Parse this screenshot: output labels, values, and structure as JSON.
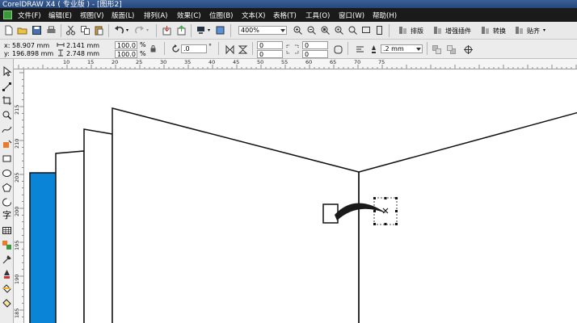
{
  "window": {
    "title": "CorelDRAW X4 ( 专业版 ) - [图形2]"
  },
  "menu": [
    "文件(F)",
    "编辑(E)",
    "视图(V)",
    "版面(L)",
    "排列(A)",
    "效果(C)",
    "位图(B)",
    "文本(X)",
    "表格(T)",
    "工具(O)",
    "窗口(W)",
    "帮助(H)"
  ],
  "toolbar": {
    "zoom": "400%",
    "buttons": {
      "arrange": "排版",
      "plugin": "增强插件",
      "convert": "转换",
      "snap": "贴齐"
    }
  },
  "property_bar": {
    "x": "58.907 mm",
    "y": "196.898 mm",
    "width": "2.141 mm",
    "height": "2.748 mm",
    "scale_x": "100.0",
    "scale_y": "100.0",
    "percent": "%",
    "rotation": ".0",
    "degree": "°",
    "corner_values": [
      "0",
      "0",
      "0",
      "0"
    ],
    "outline": ".2 mm"
  },
  "ruler": {
    "h_labels": [
      "10",
      "15",
      "20",
      "25",
      "30",
      "35",
      "40",
      "45",
      "50",
      "55",
      "60",
      "65",
      "70",
      "75"
    ],
    "v_labels": [
      "215",
      "210",
      "205",
      "200",
      "195",
      "190",
      "185"
    ]
  },
  "colors": {
    "menubar": "#1a1a1a",
    "title": "#2d4f88",
    "blue_panel": "#0a84d6",
    "ink": "#1a1a1a"
  }
}
